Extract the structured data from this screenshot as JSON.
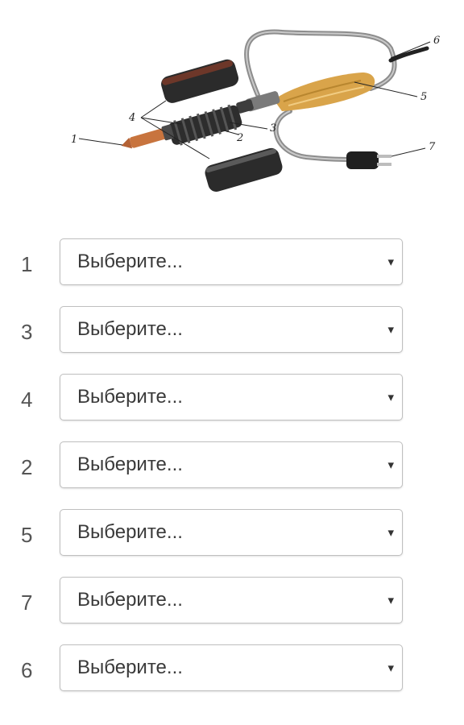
{
  "diagram": {
    "callouts": [
      "1",
      "2",
      "3",
      "4",
      "5",
      "6",
      "7"
    ]
  },
  "rows": [
    {
      "number": "1",
      "value": "Выберите..."
    },
    {
      "number": "3",
      "value": "Выберите..."
    },
    {
      "number": "4",
      "value": "Выберите..."
    },
    {
      "number": "2",
      "value": "Выберите..."
    },
    {
      "number": "5",
      "value": "Выберите..."
    },
    {
      "number": "7",
      "value": "Выберите..."
    },
    {
      "number": "6",
      "value": "Выберите..."
    }
  ],
  "caret_icon": "▾",
  "colors": {
    "handle": "#d9a44a",
    "tip": "#c8743e",
    "body": "#2b2b2b",
    "cord": "#9a9a9a"
  }
}
